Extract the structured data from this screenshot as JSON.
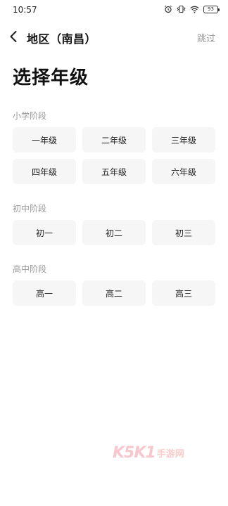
{
  "status": {
    "time": "10:57",
    "battery": "93"
  },
  "nav": {
    "title": "地区（南昌）",
    "skip": "跳过"
  },
  "page": {
    "title": "选择年级"
  },
  "sections": [
    {
      "label": "小学阶段",
      "grades": [
        "一年级",
        "二年级",
        "三年级",
        "四年级",
        "五年级",
        "六年级"
      ]
    },
    {
      "label": "初中阶段",
      "grades": [
        "初一",
        "初二",
        "初三"
      ]
    },
    {
      "label": "高中阶段",
      "grades": [
        "高一",
        "高二",
        "高三"
      ]
    }
  ],
  "watermark": {
    "brand": "K5K1",
    "cn": "手游网"
  },
  "icons": [
    "back-arrow-icon",
    "alarm-icon",
    "vibrate-icon",
    "wifi-icon",
    "battery-icon"
  ]
}
